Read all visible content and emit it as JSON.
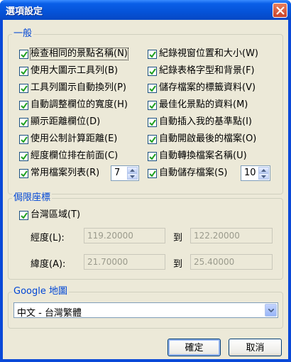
{
  "window": {
    "title": "選項設定"
  },
  "general": {
    "label": "一般",
    "left": [
      {
        "label": "檢查相同的景點名稱(N)",
        "checked": true
      },
      {
        "label": "使用大圖示工具列(B)",
        "checked": true
      },
      {
        "label": "工具列圖示自動換列(P)",
        "checked": true
      },
      {
        "label": "自動調整欄位的寬度(H)",
        "checked": true
      },
      {
        "label": "顯示距離欄位(D)",
        "checked": true
      },
      {
        "label": "使用公制計算距離(E)",
        "checked": true
      },
      {
        "label": "經度欄位排在前面(C)",
        "checked": true
      },
      {
        "label": "常用檔案列表(R)",
        "checked": true
      }
    ],
    "right": [
      {
        "label": "紀錄視窗位置和大小(W)",
        "checked": true
      },
      {
        "label": "紀錄表格字型和背景(F)",
        "checked": true
      },
      {
        "label": "儲存檔案的標籤資料(V)",
        "checked": true
      },
      {
        "label": "最佳化景點的資料(M)",
        "checked": true
      },
      {
        "label": "自動插入我的基準點(I)",
        "checked": true
      },
      {
        "label": "自動開啟最後的檔案(O)",
        "checked": true
      },
      {
        "label": "自動轉換檔案名稱(U)",
        "checked": true
      },
      {
        "label": "自動儲存檔案(S)",
        "checked": true
      }
    ],
    "recent_files_count": "7",
    "autosave_value": "10"
  },
  "bounds": {
    "label": "侷限座標",
    "region_checkbox": {
      "label": "台灣區域(T)",
      "checked": true
    },
    "longitude_label": "經度(L):",
    "longitude_from": "119.20000",
    "longitude_to": "122.20000",
    "latitude_label": "緯度(A):",
    "latitude_from": "21.70000",
    "latitude_to": "25.40000",
    "to_text": "到"
  },
  "google_map": {
    "label": "Google 地圖",
    "selected": "中文 - 台灣繁體"
  },
  "buttons": {
    "ok": "確定",
    "cancel": "取消"
  },
  "colors": {
    "title_bar": "#0553d8",
    "group_label": "#0046d5",
    "dialog_bg": "#ece9d8"
  }
}
